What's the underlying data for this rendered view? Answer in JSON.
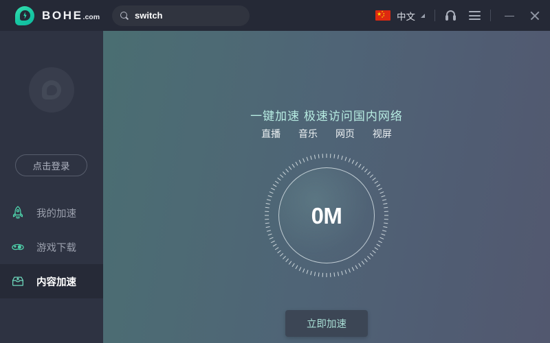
{
  "titlebar": {
    "brand_name": "BOHE",
    "brand_suffix": ".com",
    "logo_icon": "shield-bolt-icon",
    "search": {
      "icon": "search-icon",
      "value": "switch",
      "placeholder": "switch"
    },
    "language": {
      "flag_icon": "china-flag-icon",
      "label": "中文",
      "caret_icon": "chevron-down-icon"
    },
    "support_icon": "headset-icon",
    "menu_icon": "hamburger-menu-icon",
    "minimize_icon": "minimize-icon",
    "close_icon": "close-icon"
  },
  "sidebar": {
    "avatar_icon": "avatar-placeholder-icon",
    "login_label": "点击登录",
    "items": [
      {
        "label": "我的加速",
        "icon": "rocket-icon",
        "active": false
      },
      {
        "label": "游戏下载",
        "icon": "gamepad-icon",
        "active": false
      },
      {
        "label": "内容加速",
        "icon": "archive-box-icon",
        "active": true
      }
    ]
  },
  "main": {
    "headline": "一键加速 极速访问国内网络",
    "subnav": [
      {
        "label": "直播"
      },
      {
        "label": "音乐"
      },
      {
        "label": "网页"
      },
      {
        "label": "视屏"
      }
    ],
    "gauge": {
      "value": "0M",
      "ticks": 96
    },
    "cta_label": "立即加速"
  },
  "colors": {
    "accent_teal": "#2ddcae",
    "titlebar_bg": "#252936",
    "sidebar_bg": "#2e3342",
    "sidebar_active_bg": "#262a37",
    "headline_color": "#b7ece2",
    "cta_bg": "#3c4655",
    "cta_text": "#a8ded5",
    "flag_red": "#de2910",
    "flag_yellow": "#ffde00"
  }
}
